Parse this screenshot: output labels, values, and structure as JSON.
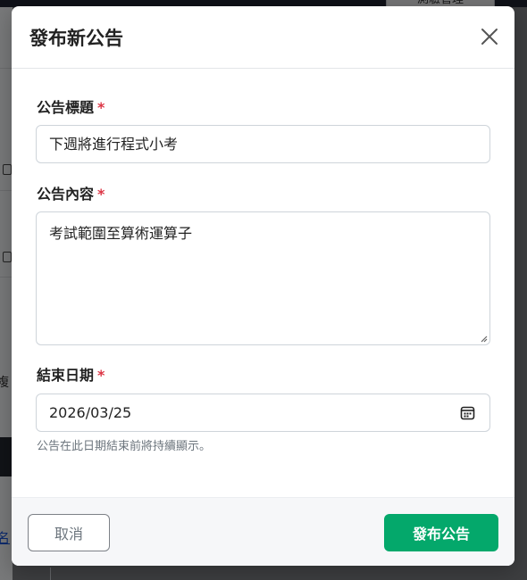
{
  "background": {
    "top_button_label": "測驗管理",
    "side_text": "複",
    "side_link": "名"
  },
  "modal": {
    "title": "發布新公告",
    "close_icon": "close-icon",
    "fields": {
      "title_label": "公告標題",
      "title_value": "下週將進行程式小考",
      "content_label": "公告內容",
      "content_value": "考試範圍至算術運算子",
      "end_date_label": "結束日期",
      "end_date_value": "2026/03/25",
      "end_date_help": "公告在此日期結束前將持續顯示。",
      "required_mark": "*"
    },
    "footer": {
      "cancel_label": "取消",
      "submit_label": "發布公告"
    }
  },
  "colors": {
    "primary": "#04a86b",
    "required": "#dc3545"
  }
}
